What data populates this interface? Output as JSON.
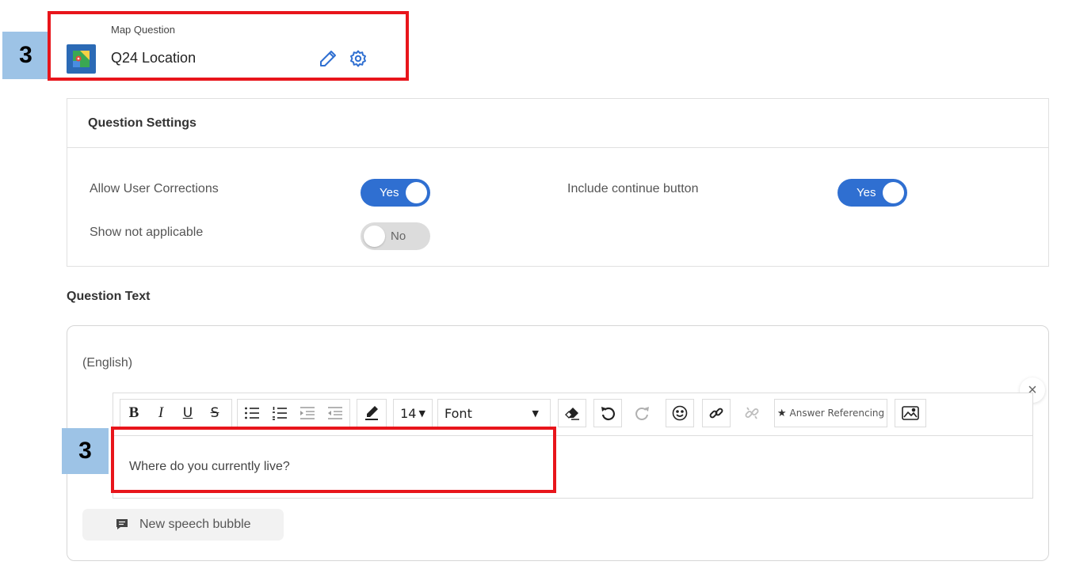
{
  "callouts": [
    "3",
    "3"
  ],
  "question": {
    "type_label": "Map Question",
    "title": "Q24 Location",
    "icon": "map-icon"
  },
  "settings": {
    "title": "Question Settings",
    "allow_corrections": {
      "label": "Allow User Corrections",
      "value": "Yes"
    },
    "include_continue": {
      "label": "Include continue button",
      "value": "Yes"
    },
    "show_not_applicable": {
      "label": "Show not applicable",
      "value": "No"
    }
  },
  "question_text": {
    "section_title": "Question Text",
    "language": "(English)",
    "font_size": "14",
    "font_name": "Font",
    "answer_referencing": "Answer Referencing",
    "body": "Where do you currently live?",
    "new_bubble": "New speech bubble"
  },
  "colors": {
    "accent": "#2f6fd1",
    "callout_fill": "#9dc3e6",
    "highlight": "#e8151b"
  }
}
